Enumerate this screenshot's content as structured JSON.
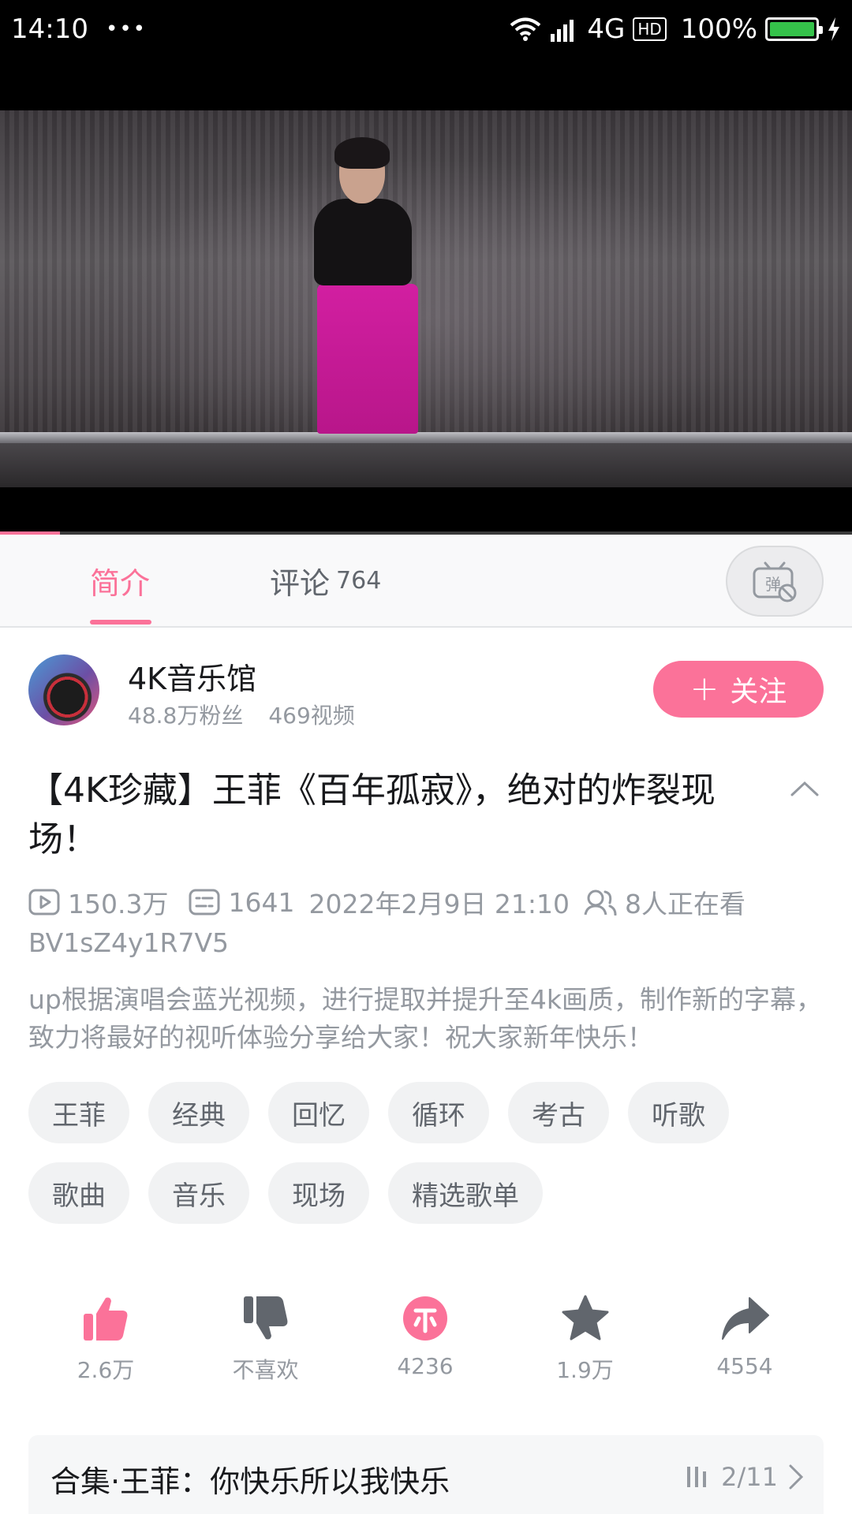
{
  "status_bar": {
    "time": "14:10",
    "dots": "•••",
    "network": "4G",
    "hd": "HD",
    "battery": "100%"
  },
  "video": {
    "progress_fraction": 0.07
  },
  "tabs": {
    "intro": "简介",
    "comments": "评论",
    "comments_count": "764",
    "danmaku_icon": "danmaku-toggle-icon"
  },
  "uploader": {
    "name": "4K音乐馆",
    "fans": "48.8万粉丝",
    "videos": "469视频",
    "follow_label": "关注"
  },
  "video_info": {
    "title": "【4K珍藏】王菲《百年孤寂》，绝对的炸裂现场！",
    "views": "150.3万",
    "danmaku": "1641",
    "datetime": "2022年2月9日 21:10",
    "watching": "8人正在看",
    "bvid": "BV1sZ4y1R7V5",
    "description": "up根据演唱会蓝光视频，进行提取并提升至4k画质，制作新的字幕，致力将最好的视听体验分享给大家！祝大家新年快乐！"
  },
  "tags": {
    "row1": [
      "王菲",
      "经典",
      "回忆",
      "循环",
      "考古",
      "听歌"
    ],
    "row2": [
      "歌曲",
      "音乐",
      "现场",
      "精选歌单"
    ]
  },
  "actions": {
    "like": "2.6万",
    "dislike": "不喜欢",
    "coin": "4236",
    "favorite": "1.9万",
    "share": "4554"
  },
  "collection": {
    "title": "合集·王菲：你快乐所以我快乐",
    "position": "2/11"
  },
  "colors": {
    "accent": "#fb7299",
    "muted": "#9499a0",
    "icon_dark": "#61666d"
  }
}
